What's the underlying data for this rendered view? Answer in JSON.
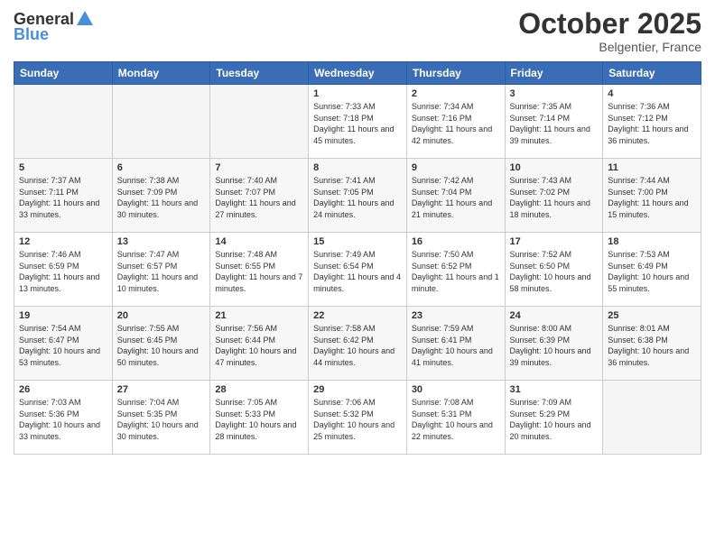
{
  "header": {
    "logo_general": "General",
    "logo_blue": "Blue",
    "month": "October 2025",
    "location": "Belgentier, France"
  },
  "weekdays": [
    "Sunday",
    "Monday",
    "Tuesday",
    "Wednesday",
    "Thursday",
    "Friday",
    "Saturday"
  ],
  "weeks": [
    [
      {
        "day": "",
        "info": ""
      },
      {
        "day": "",
        "info": ""
      },
      {
        "day": "",
        "info": ""
      },
      {
        "day": "1",
        "info": "Sunrise: 7:33 AM\nSunset: 7:18 PM\nDaylight: 11 hours and 45 minutes."
      },
      {
        "day": "2",
        "info": "Sunrise: 7:34 AM\nSunset: 7:16 PM\nDaylight: 11 hours and 42 minutes."
      },
      {
        "day": "3",
        "info": "Sunrise: 7:35 AM\nSunset: 7:14 PM\nDaylight: 11 hours and 39 minutes."
      },
      {
        "day": "4",
        "info": "Sunrise: 7:36 AM\nSunset: 7:12 PM\nDaylight: 11 hours and 36 minutes."
      }
    ],
    [
      {
        "day": "5",
        "info": "Sunrise: 7:37 AM\nSunset: 7:11 PM\nDaylight: 11 hours and 33 minutes."
      },
      {
        "day": "6",
        "info": "Sunrise: 7:38 AM\nSunset: 7:09 PM\nDaylight: 11 hours and 30 minutes."
      },
      {
        "day": "7",
        "info": "Sunrise: 7:40 AM\nSunset: 7:07 PM\nDaylight: 11 hours and 27 minutes."
      },
      {
        "day": "8",
        "info": "Sunrise: 7:41 AM\nSunset: 7:05 PM\nDaylight: 11 hours and 24 minutes."
      },
      {
        "day": "9",
        "info": "Sunrise: 7:42 AM\nSunset: 7:04 PM\nDaylight: 11 hours and 21 minutes."
      },
      {
        "day": "10",
        "info": "Sunrise: 7:43 AM\nSunset: 7:02 PM\nDaylight: 11 hours and 18 minutes."
      },
      {
        "day": "11",
        "info": "Sunrise: 7:44 AM\nSunset: 7:00 PM\nDaylight: 11 hours and 15 minutes."
      }
    ],
    [
      {
        "day": "12",
        "info": "Sunrise: 7:46 AM\nSunset: 6:59 PM\nDaylight: 11 hours and 13 minutes."
      },
      {
        "day": "13",
        "info": "Sunrise: 7:47 AM\nSunset: 6:57 PM\nDaylight: 11 hours and 10 minutes."
      },
      {
        "day": "14",
        "info": "Sunrise: 7:48 AM\nSunset: 6:55 PM\nDaylight: 11 hours and 7 minutes."
      },
      {
        "day": "15",
        "info": "Sunrise: 7:49 AM\nSunset: 6:54 PM\nDaylight: 11 hours and 4 minutes."
      },
      {
        "day": "16",
        "info": "Sunrise: 7:50 AM\nSunset: 6:52 PM\nDaylight: 11 hours and 1 minute."
      },
      {
        "day": "17",
        "info": "Sunrise: 7:52 AM\nSunset: 6:50 PM\nDaylight: 10 hours and 58 minutes."
      },
      {
        "day": "18",
        "info": "Sunrise: 7:53 AM\nSunset: 6:49 PM\nDaylight: 10 hours and 55 minutes."
      }
    ],
    [
      {
        "day": "19",
        "info": "Sunrise: 7:54 AM\nSunset: 6:47 PM\nDaylight: 10 hours and 53 minutes."
      },
      {
        "day": "20",
        "info": "Sunrise: 7:55 AM\nSunset: 6:45 PM\nDaylight: 10 hours and 50 minutes."
      },
      {
        "day": "21",
        "info": "Sunrise: 7:56 AM\nSunset: 6:44 PM\nDaylight: 10 hours and 47 minutes."
      },
      {
        "day": "22",
        "info": "Sunrise: 7:58 AM\nSunset: 6:42 PM\nDaylight: 10 hours and 44 minutes."
      },
      {
        "day": "23",
        "info": "Sunrise: 7:59 AM\nSunset: 6:41 PM\nDaylight: 10 hours and 41 minutes."
      },
      {
        "day": "24",
        "info": "Sunrise: 8:00 AM\nSunset: 6:39 PM\nDaylight: 10 hours and 39 minutes."
      },
      {
        "day": "25",
        "info": "Sunrise: 8:01 AM\nSunset: 6:38 PM\nDaylight: 10 hours and 36 minutes."
      }
    ],
    [
      {
        "day": "26",
        "info": "Sunrise: 7:03 AM\nSunset: 5:36 PM\nDaylight: 10 hours and 33 minutes."
      },
      {
        "day": "27",
        "info": "Sunrise: 7:04 AM\nSunset: 5:35 PM\nDaylight: 10 hours and 30 minutes."
      },
      {
        "day": "28",
        "info": "Sunrise: 7:05 AM\nSunset: 5:33 PM\nDaylight: 10 hours and 28 minutes."
      },
      {
        "day": "29",
        "info": "Sunrise: 7:06 AM\nSunset: 5:32 PM\nDaylight: 10 hours and 25 minutes."
      },
      {
        "day": "30",
        "info": "Sunrise: 7:08 AM\nSunset: 5:31 PM\nDaylight: 10 hours and 22 minutes."
      },
      {
        "day": "31",
        "info": "Sunrise: 7:09 AM\nSunset: 5:29 PM\nDaylight: 10 hours and 20 minutes."
      },
      {
        "day": "",
        "info": ""
      }
    ]
  ]
}
